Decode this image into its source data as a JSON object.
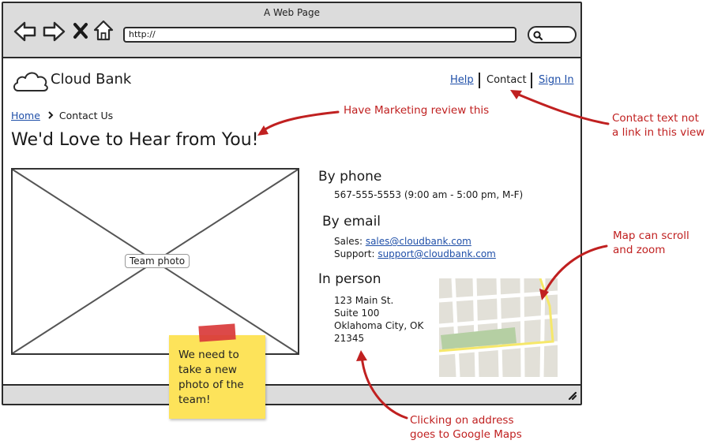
{
  "browser": {
    "window_title": "A Web Page",
    "url": "http://"
  },
  "site": {
    "logo_text": "Cloud Bank",
    "nav": {
      "help": "Help",
      "contact": "Contact",
      "sign_in": "Sign In"
    },
    "breadcrumb": {
      "home": "Home",
      "current": "Contact Us"
    },
    "page_title": "We'd Love to Hear from You!",
    "photo_placeholder": "Team photo",
    "phone": {
      "heading": "By phone",
      "line": "567-555-5553 (9:00 am - 5:00 pm, M-F)"
    },
    "email": {
      "heading": "By email",
      "sales_label": "Sales:",
      "sales_address": "sales@cloudbank.com",
      "support_label": "Support:",
      "support_address": "support@cloudbank.com"
    },
    "in_person": {
      "heading": "In person",
      "address_lines": [
        "123 Main St.",
        "Suite 100",
        "Oklahoma City, OK",
        "21345"
      ]
    }
  },
  "sticky_note": {
    "text_lines": [
      "We need to",
      "take a new",
      "photo of the",
      "team!"
    ]
  },
  "annotations": {
    "marketing": "Have Marketing review this",
    "contact_lines": [
      "Contact text not",
      "a link in this view"
    ],
    "map_lines": [
      "Map can scroll",
      "and zoom"
    ],
    "address_lines": [
      "Clicking on address",
      "goes to Google Maps"
    ]
  },
  "colors": {
    "link": "#1f4fa8",
    "annotation": "#c02020",
    "sticky": "#fde35a",
    "chrome": "#dcdcdc"
  },
  "icons": [
    "back-arrow-icon",
    "forward-arrow-icon",
    "close-icon",
    "home-icon",
    "search-icon",
    "cloud-icon",
    "chevron-right-icon",
    "resize-grip-icon"
  ]
}
